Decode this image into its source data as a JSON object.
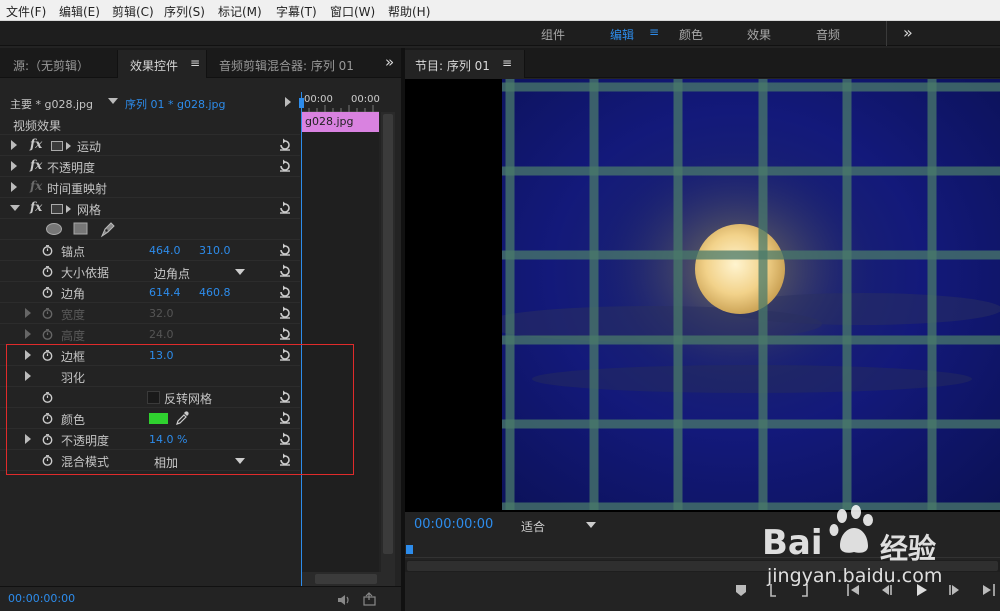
{
  "menubar": {
    "items": [
      "文件(F)",
      "编辑(E)",
      "剪辑(C)",
      "序列(S)",
      "标记(M)",
      "字幕(T)",
      "窗口(W)",
      "帮助(H)"
    ]
  },
  "workspaces": {
    "tabs": [
      "组件",
      "编辑",
      "颜色",
      "效果",
      "音频"
    ],
    "active": "编辑",
    "menu_glyph": "≡",
    "more_glyph": "»"
  },
  "left_panel": {
    "tabs": {
      "source": "源:（无剪辑）",
      "effect_controls": "效果控件",
      "audio_mixer": "音频剪辑混合器: 序列 01"
    },
    "menu_glyph": "≡",
    "more_glyph": "»",
    "master_clip": "主要 * g028.jpg",
    "sequence_clip": "序列 01 * g028.jpg",
    "timecode_start": "00:00",
    "timecode_end": "00:00",
    "clip_name": "g028.jpg",
    "section_title": "视频效果",
    "effects": {
      "motion": "运动",
      "opacity": "不透明度",
      "time_remap": "时间重映射",
      "grid": "网格"
    },
    "fx_symbol": "fx",
    "properties": {
      "anchor": {
        "label": "锚点",
        "x": "464.0",
        "y": "310.0"
      },
      "size_from": {
        "label": "大小依据",
        "value": "边角点"
      },
      "corner": {
        "label": "边角",
        "x": "614.4",
        "y": "460.8"
      },
      "width": {
        "label": "宽度",
        "value": "32.0"
      },
      "height": {
        "label": "高度",
        "value": "24.0"
      },
      "border": {
        "label": "边框",
        "value": "13.0"
      },
      "feather": {
        "label": "羽化"
      },
      "invert": {
        "label": "反转网格"
      },
      "color": {
        "label": "颜色",
        "swatch": "#2fd12f"
      },
      "grid_opacity": {
        "label": "不透明度",
        "value": "14.0 %"
      },
      "blend": {
        "label": "混合模式",
        "value": "相加"
      }
    },
    "footer_timecode": "00:00:00:00"
  },
  "program": {
    "tab_label": "节目: 序列 01",
    "menu_glyph": "≡",
    "timecode": "00:00:00:00",
    "fit": "适合"
  },
  "watermark": {
    "logo": "Bai",
    "text": "经验",
    "url": "jingyan.baidu.com"
  },
  "colors": {
    "accent": "#2d8ceb",
    "highlight_box": "#e02b2b",
    "clip": "#d982e0"
  }
}
